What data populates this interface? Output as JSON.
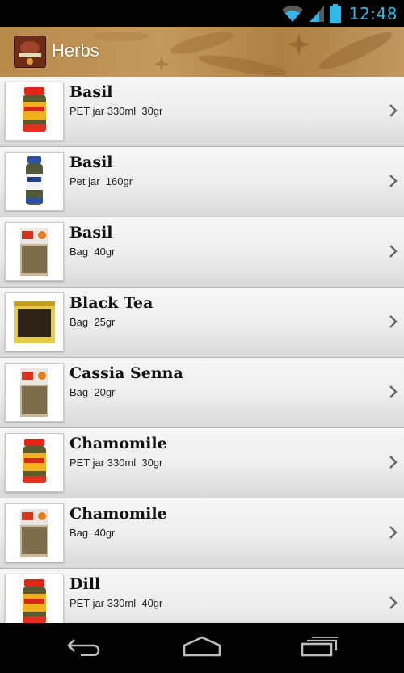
{
  "status_bar": {
    "time": "12:48",
    "icons": [
      "wifi-icon",
      "signal-icon",
      "battery-icon"
    ],
    "accent_color": "#33b5e5"
  },
  "action_bar": {
    "title": "Herbs",
    "logo_icon": "app-logo-icon"
  },
  "items": [
    {
      "name": "Basil",
      "detail": "PET jar 330ml  30gr",
      "package": "jar-red"
    },
    {
      "name": "Basil",
      "detail": "Pet jar  160gr",
      "package": "jar-blue"
    },
    {
      "name": "Basil",
      "detail": "Bag  40gr",
      "package": "bag"
    },
    {
      "name": "Black Tea",
      "detail": "Bag  25gr",
      "package": "bag-yellow"
    },
    {
      "name": "Cassia Senna",
      "detail": "Bag  20gr",
      "package": "bag"
    },
    {
      "name": "Chamomile",
      "detail": "PET jar 330ml  30gr",
      "package": "jar-red"
    },
    {
      "name": "Chamomile",
      "detail": "Bag  40gr",
      "package": "bag"
    },
    {
      "name": "Dill",
      "detail": "PET jar 330ml  40gr",
      "package": "jar-red"
    }
  ],
  "nav_bar": {
    "icons": [
      "back-icon",
      "home-icon",
      "recent-apps-icon"
    ]
  }
}
